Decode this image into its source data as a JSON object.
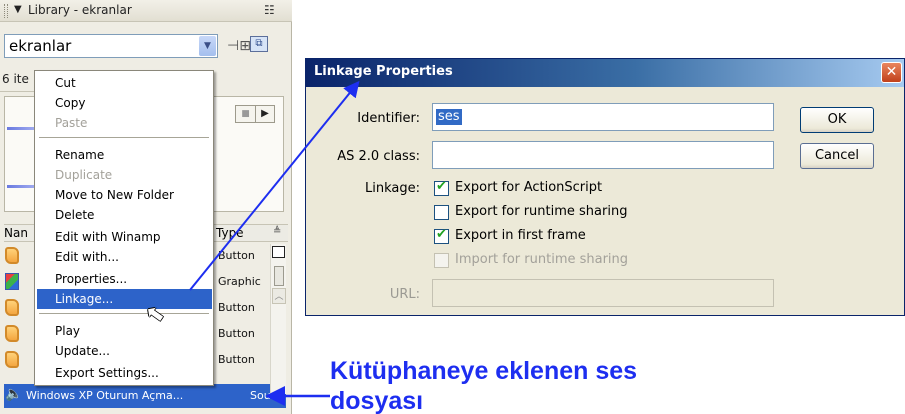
{
  "library": {
    "title": "Library - ekranlar",
    "combo_value": "ekranlar",
    "item_count": "6 ite",
    "column_name": "Nan",
    "column_type": "Type",
    "rows": [
      {
        "symbol": "button-symbol-icon",
        "type": "Button"
      },
      {
        "symbol": "graphic-symbol-icon",
        "type": "Graphic"
      },
      {
        "symbol": "button-symbol-icon",
        "type": "Button"
      },
      {
        "symbol": "button-symbol-icon",
        "type": "Button"
      },
      {
        "symbol": "button-symbol-icon",
        "type": "Button"
      }
    ],
    "selected_row": {
      "name": "Windows XP Oturum Açma...",
      "type": "Sound",
      "icon": "sound-icon"
    }
  },
  "context_menu": {
    "items": [
      {
        "label": "Cut",
        "state": "enabled"
      },
      {
        "label": "Copy",
        "state": "enabled"
      },
      {
        "label": "Paste",
        "state": "disabled"
      },
      {
        "label": "Rename",
        "state": "enabled"
      },
      {
        "label": "Duplicate",
        "state": "disabled"
      },
      {
        "label": "Move to New Folder",
        "state": "enabled"
      },
      {
        "label": "Delete",
        "state": "enabled"
      },
      {
        "label": "Edit with Winamp",
        "state": "enabled"
      },
      {
        "label": "Edit with...",
        "state": "enabled"
      },
      {
        "label": "Properties...",
        "state": "enabled"
      },
      {
        "label": "Linkage...",
        "state": "highlighted"
      },
      {
        "label": "Play",
        "state": "enabled"
      },
      {
        "label": "Update...",
        "state": "enabled"
      },
      {
        "label": "Export Settings...",
        "state": "enabled"
      }
    ]
  },
  "dialog": {
    "title": "Linkage Properties",
    "identifier_label": "Identifier:",
    "identifier_value": "ses",
    "class_label": "AS 2.0 class:",
    "class_value": "",
    "linkage_label": "Linkage:",
    "options": [
      {
        "label": "Export for ActionScript",
        "checked": true,
        "enabled": true
      },
      {
        "label": "Export for runtime sharing",
        "checked": false,
        "enabled": true
      },
      {
        "label": "Export in first frame",
        "checked": true,
        "enabled": true
      },
      {
        "label": "Import for runtime sharing",
        "checked": false,
        "enabled": false
      }
    ],
    "url_label": "URL:",
    "url_value": "",
    "ok_label": "OK",
    "cancel_label": "Cancel"
  },
  "annotation": {
    "caption": "Kütüphaneye eklenen ses dosyası",
    "color": "#1d2ef0"
  },
  "colors": {
    "selection": "#2d63c9",
    "dialog_title": "#0a246a",
    "check": "#21a121"
  }
}
